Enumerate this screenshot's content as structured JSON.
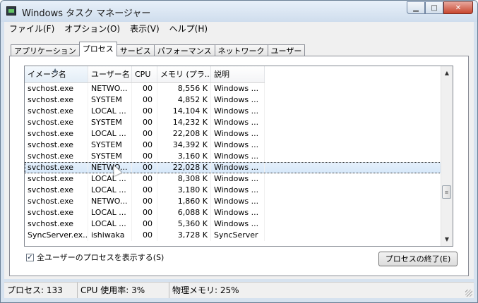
{
  "window": {
    "title": "Windows タスク マネージャー"
  },
  "menu": [
    "ファイル(F)",
    "オプション(O)",
    "表示(V)",
    "ヘルプ(H)"
  ],
  "tabs": [
    "アプリケーション",
    "プロセス",
    "サービス",
    "パフォーマンス",
    "ネットワーク",
    "ユーザー"
  ],
  "active_tab": "プロセス",
  "columns": [
    "イメージ名",
    "ユーザー名",
    "CPU",
    "メモリ (プラ...",
    "説明"
  ],
  "rows": [
    [
      "svchost.exe",
      "NETWO...",
      "00",
      "8,556 K",
      "Windows ..."
    ],
    [
      "svchost.exe",
      "SYSTEM",
      "00",
      "4,852 K",
      "Windows ..."
    ],
    [
      "svchost.exe",
      "LOCAL ...",
      "00",
      "14,104 K",
      "Windows ..."
    ],
    [
      "svchost.exe",
      "SYSTEM",
      "00",
      "14,232 K",
      "Windows ..."
    ],
    [
      "svchost.exe",
      "LOCAL ...",
      "00",
      "22,208 K",
      "Windows ..."
    ],
    [
      "svchost.exe",
      "SYSTEM",
      "00",
      "34,392 K",
      "Windows ..."
    ],
    [
      "svchost.exe",
      "SYSTEM",
      "00",
      "3,160 K",
      "Windows ..."
    ],
    [
      "svchost.exe",
      "NETWO...",
      "00",
      "22,028 K",
      "Windows ..."
    ],
    [
      "svchost.exe",
      "LOCAL ...",
      "00",
      "8,308 K",
      "Windows ..."
    ],
    [
      "svchost.exe",
      "LOCAL ...",
      "00",
      "3,180 K",
      "Windows ..."
    ],
    [
      "svchost.exe",
      "NETWO...",
      "00",
      "1,860 K",
      "Windows ..."
    ],
    [
      "svchost.exe",
      "LOCAL ...",
      "00",
      "6,088 K",
      "Windows ..."
    ],
    [
      "svchost.exe",
      "LOCAL ...",
      "00",
      "5,360 K",
      "Windows ..."
    ],
    [
      "SyncServer.ex...",
      "ishiwaka",
      "00",
      "3,728 K",
      "SyncServer"
    ]
  ],
  "selected_row": 7,
  "show_all_users": {
    "label": "全ユーザーのプロセスを表示する(S)",
    "checked": true
  },
  "end_process_button": "プロセスの終了(E)",
  "status": {
    "processes": "プロセス: 133",
    "cpu": "CPU 使用率: 3%",
    "memory": "物理メモリ: 25%"
  }
}
